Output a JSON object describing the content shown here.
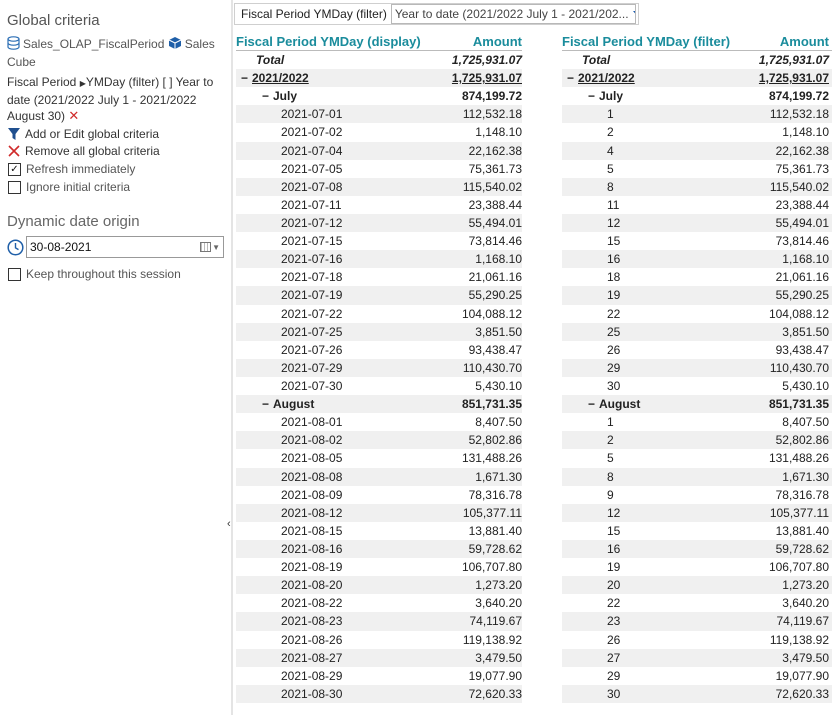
{
  "sidebar": {
    "title": "Global criteria",
    "source_name": "Sales_OLAP_FiscalPeriod",
    "source_cube": "Sales Cube",
    "criterion": {
      "dimension": "Fiscal Period",
      "hierarchy": "YMDay (filter) [ ] Year to date (2021/2022 July 1 - 2021/2022 August 30)"
    },
    "add_edit_label": "Add or Edit global criteria",
    "remove_all_label": "Remove all global criteria",
    "refresh_label": "Refresh immediately",
    "refresh_checked": true,
    "ignore_label": "Ignore initial criteria",
    "ignore_checked": false,
    "dynamic_date_title": "Dynamic date origin",
    "date_value": "30-08-2021",
    "keep_label": "Keep throughout this session",
    "keep_checked": false
  },
  "filter": {
    "label": "Fiscal Period YMDay (filter)",
    "value": "Year to date (2021/2022 July 1 - 2021/202..."
  },
  "table1": {
    "col1": "Fiscal Period YMDay (display)",
    "col2": "Amount",
    "total_label": "Total",
    "total": "1,725,931.07",
    "year_label": "2021/2022",
    "year_total": "1,725,931.07",
    "july_label": "July",
    "july_total": "874,199.72",
    "july_rows": [
      [
        "2021-07-01",
        "112,532.18"
      ],
      [
        "2021-07-02",
        "1,148.10"
      ],
      [
        "2021-07-04",
        "22,162.38"
      ],
      [
        "2021-07-05",
        "75,361.73"
      ],
      [
        "2021-07-08",
        "115,540.02"
      ],
      [
        "2021-07-11",
        "23,388.44"
      ],
      [
        "2021-07-12",
        "55,494.01"
      ],
      [
        "2021-07-15",
        "73,814.46"
      ],
      [
        "2021-07-16",
        "1,168.10"
      ],
      [
        "2021-07-18",
        "21,061.16"
      ],
      [
        "2021-07-19",
        "55,290.25"
      ],
      [
        "2021-07-22",
        "104,088.12"
      ],
      [
        "2021-07-25",
        "3,851.50"
      ],
      [
        "2021-07-26",
        "93,438.47"
      ],
      [
        "2021-07-29",
        "110,430.70"
      ],
      [
        "2021-07-30",
        "5,430.10"
      ]
    ],
    "august_label": "August",
    "august_total": "851,731.35",
    "august_rows": [
      [
        "2021-08-01",
        "8,407.50"
      ],
      [
        "2021-08-02",
        "52,802.86"
      ],
      [
        "2021-08-05",
        "131,488.26"
      ],
      [
        "2021-08-08",
        "1,671.30"
      ],
      [
        "2021-08-09",
        "78,316.78"
      ],
      [
        "2021-08-12",
        "105,377.11"
      ],
      [
        "2021-08-15",
        "13,881.40"
      ],
      [
        "2021-08-16",
        "59,728.62"
      ],
      [
        "2021-08-19",
        "106,707.80"
      ],
      [
        "2021-08-20",
        "1,273.20"
      ],
      [
        "2021-08-22",
        "3,640.20"
      ],
      [
        "2021-08-23",
        "74,119.67"
      ],
      [
        "2021-08-26",
        "119,138.92"
      ],
      [
        "2021-08-27",
        "3,479.50"
      ],
      [
        "2021-08-29",
        "19,077.90"
      ],
      [
        "2021-08-30",
        "72,620.33"
      ]
    ]
  },
  "table2": {
    "col1": "Fiscal Period YMDay (filter)",
    "col2": "Amount",
    "total_label": "Total",
    "total": "1,725,931.07",
    "year_label": "2021/2022",
    "year_total": "1,725,931.07",
    "july_label": "July",
    "july_total": "874,199.72",
    "july_rows": [
      [
        "1",
        "112,532.18"
      ],
      [
        "2",
        "1,148.10"
      ],
      [
        "4",
        "22,162.38"
      ],
      [
        "5",
        "75,361.73"
      ],
      [
        "8",
        "115,540.02"
      ],
      [
        "11",
        "23,388.44"
      ],
      [
        "12",
        "55,494.01"
      ],
      [
        "15",
        "73,814.46"
      ],
      [
        "16",
        "1,168.10"
      ],
      [
        "18",
        "21,061.16"
      ],
      [
        "19",
        "55,290.25"
      ],
      [
        "22",
        "104,088.12"
      ],
      [
        "25",
        "3,851.50"
      ],
      [
        "26",
        "93,438.47"
      ],
      [
        "29",
        "110,430.70"
      ],
      [
        "30",
        "5,430.10"
      ]
    ],
    "august_label": "August",
    "august_total": "851,731.35",
    "august_rows": [
      [
        "1",
        "8,407.50"
      ],
      [
        "2",
        "52,802.86"
      ],
      [
        "5",
        "131,488.26"
      ],
      [
        "8",
        "1,671.30"
      ],
      [
        "9",
        "78,316.78"
      ],
      [
        "12",
        "105,377.11"
      ],
      [
        "15",
        "13,881.40"
      ],
      [
        "16",
        "59,728.62"
      ],
      [
        "19",
        "106,707.80"
      ],
      [
        "20",
        "1,273.20"
      ],
      [
        "22",
        "3,640.20"
      ],
      [
        "23",
        "74,119.67"
      ],
      [
        "26",
        "119,138.92"
      ],
      [
        "27",
        "3,479.50"
      ],
      [
        "29",
        "19,077.90"
      ],
      [
        "30",
        "72,620.33"
      ]
    ]
  },
  "colors": {
    "header_teal": "#1a8c9c",
    "remove_red": "#d02a2a",
    "dropdown_blue": "#1f5fb0",
    "row_alt": "#f0f0f0"
  },
  "icons": [
    "database-icon",
    "cube-icon",
    "filter-funnel-icon",
    "remove-x-icon",
    "clock-icon",
    "calendar-icon",
    "chevron-down-icon"
  ]
}
